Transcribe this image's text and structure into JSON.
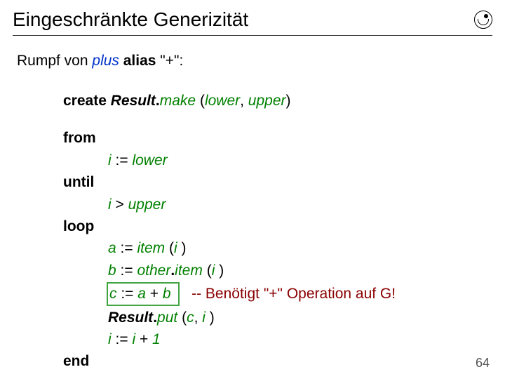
{
  "title": "Eingeschränkte Generizität",
  "intro_prefix": "Rumpf von ",
  "intro_ident": "plus ",
  "intro_kw": "alias ",
  "intro_suffix": "\"+\":",
  "create": {
    "kw": "create ",
    "res": "Result",
    "dot": ".",
    "mk": "make ",
    "args_open": "(",
    "a1": "lower",
    "comma": ", ",
    "a2": "upper",
    "args_close": ")"
  },
  "from": "from",
  "line1": {
    "i": "i ",
    "assign": ":= ",
    "lower": "lower"
  },
  "until": "until",
  "line2": {
    "i": "i ",
    "gt": "> ",
    "upper": "upper"
  },
  "loop": "loop",
  "line3": {
    "a": "a ",
    "assign": ":= ",
    "item": "item ",
    "open": "(",
    "i": "i ",
    "close": ")"
  },
  "line4": {
    "b": "b ",
    "assign": ":= ",
    "other": "other",
    "dot": ".",
    "item": "item ",
    "open": "(",
    "i": "i ",
    "close": ")"
  },
  "line5": {
    "c": "c ",
    "assign": ":= ",
    "a": "a ",
    "plus": "+ ",
    "b": "b",
    "comment": "-- Benötigt \"+\" Operation auf G!"
  },
  "line6": {
    "res": "Result",
    "dot": ".",
    "put": "put ",
    "open": "(",
    "c": "c",
    "comma": ", ",
    "i": "i ",
    "close": ")"
  },
  "line7": {
    "i": "i ",
    "assign": ":= ",
    "i2": "i ",
    "plus": "+ ",
    "one": "1"
  },
  "end": "end",
  "page": "64"
}
